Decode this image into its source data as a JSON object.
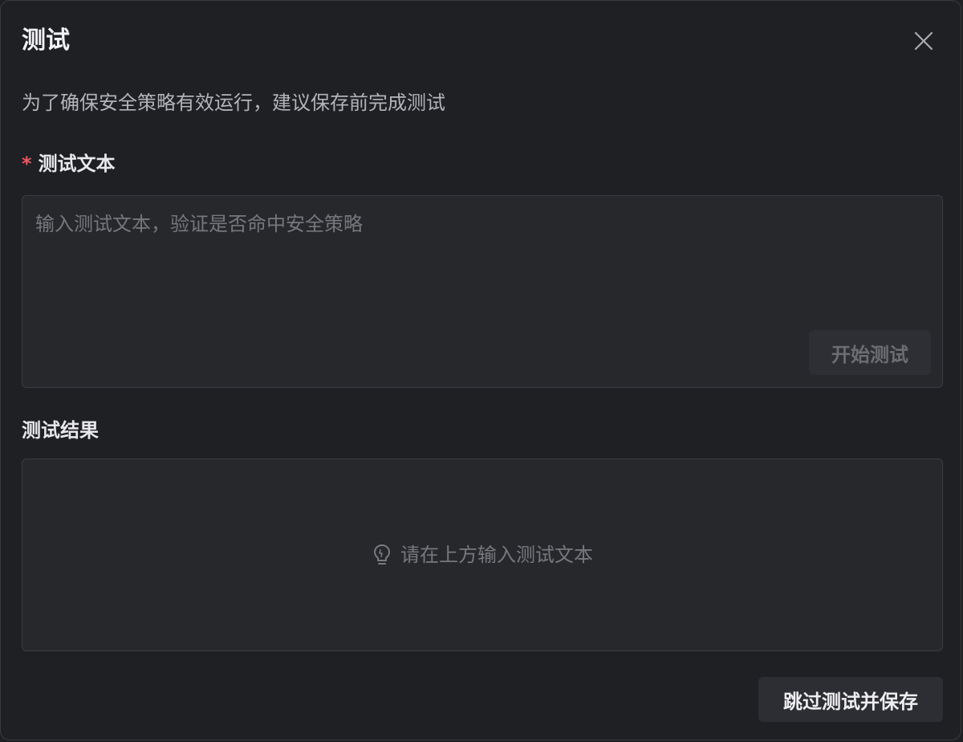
{
  "dialog": {
    "title": "测试",
    "description": "为了确保安全策略有效运行，建议保存前完成测试"
  },
  "test_text": {
    "required_mark": "*",
    "label": "测试文本",
    "value": "",
    "placeholder": "输入测试文本，验证是否命中安全策略",
    "start_button_label": "开始测试"
  },
  "test_result": {
    "label": "测试结果",
    "empty_hint": "请在上方输入测试文本",
    "empty_icon": "lightbulb-icon"
  },
  "footer": {
    "skip_button_label": "跳过测试并保存"
  },
  "icons": {
    "close": "close-icon"
  },
  "colors": {
    "background": "#1f2024",
    "surface": "#27282c",
    "required": "#f0565e"
  }
}
